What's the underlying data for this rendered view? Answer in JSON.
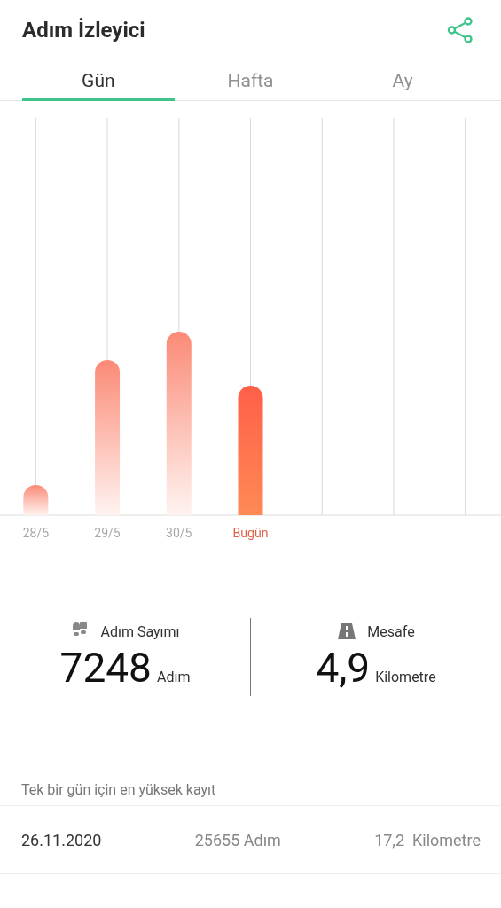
{
  "header": {
    "title": "Adım İzleyici"
  },
  "tabs": [
    {
      "label": "Gün",
      "selected": true
    },
    {
      "label": "Hafta",
      "selected": false
    },
    {
      "label": "Ay",
      "selected": false
    }
  ],
  "chart": {
    "days": [
      {
        "label": "28/5",
        "selected": false
      },
      {
        "label": "29/5",
        "selected": false
      },
      {
        "label": "30/5",
        "selected": false
      },
      {
        "label": "Bugün",
        "selected": true
      }
    ]
  },
  "stats": [
    {
      "kind": "steps",
      "label": "Adım Sayımı",
      "value": "7248",
      "unit": "Adım"
    },
    {
      "kind": "distance",
      "label": "Mesafe",
      "value": "4,9",
      "unit": "Kilometre"
    }
  ],
  "record": {
    "caption": "Tek bir gün için en yüksek kayıt",
    "date": "26.11.2020",
    "steps": "25655 Adım",
    "distance": "17,2  Kilometre"
  }
}
